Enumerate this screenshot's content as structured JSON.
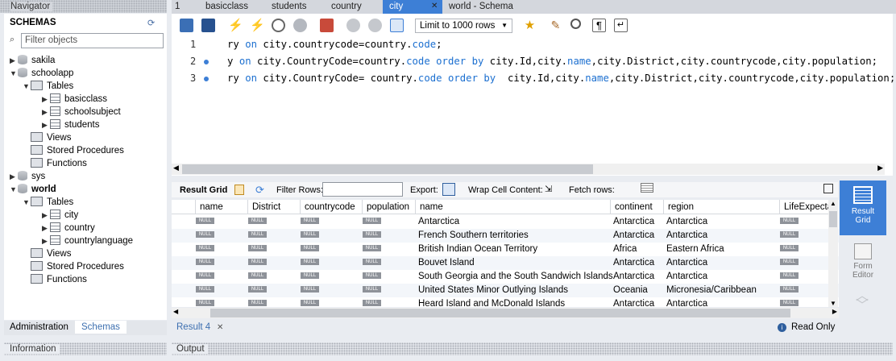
{
  "navigator": {
    "header": "Navigator",
    "schemas_title": "SCHEMAS",
    "filter_placeholder": "Filter objects"
  },
  "tree": [
    {
      "label": "sakila",
      "kind": "db",
      "arrow": "▶",
      "indent": 0
    },
    {
      "label": "schoolapp",
      "kind": "db",
      "arrow": "▼",
      "indent": 0
    },
    {
      "label": "Tables",
      "kind": "folder",
      "arrow": "▼",
      "indent": 1
    },
    {
      "label": "basicclass",
      "kind": "table",
      "arrow": "▶",
      "indent": 2
    },
    {
      "label": "schoolsubject",
      "kind": "table",
      "arrow": "▶",
      "indent": 2
    },
    {
      "label": "students",
      "kind": "table",
      "arrow": "▶",
      "indent": 2
    },
    {
      "label": "Views",
      "kind": "folder",
      "arrow": "",
      "indent": 1
    },
    {
      "label": "Stored Procedures",
      "kind": "folder",
      "arrow": "",
      "indent": 1
    },
    {
      "label": "Functions",
      "kind": "folder",
      "arrow": "",
      "indent": 1
    },
    {
      "label": "sys",
      "kind": "db",
      "arrow": "▶",
      "indent": 0
    },
    {
      "label": "world",
      "kind": "db",
      "arrow": "▼",
      "indent": 0,
      "bold": true
    },
    {
      "label": "Tables",
      "kind": "folder",
      "arrow": "▼",
      "indent": 1
    },
    {
      "label": "city",
      "kind": "table",
      "arrow": "▶",
      "indent": 2
    },
    {
      "label": "country",
      "kind": "table",
      "arrow": "▶",
      "indent": 2
    },
    {
      "label": "countrylanguage",
      "kind": "table",
      "arrow": "▶",
      "indent": 2
    },
    {
      "label": "Views",
      "kind": "folder",
      "arrow": "",
      "indent": 1
    },
    {
      "label": "Stored Procedures",
      "kind": "folder",
      "arrow": "",
      "indent": 1
    },
    {
      "label": "Functions",
      "kind": "folder",
      "arrow": "",
      "indent": 1
    }
  ],
  "bottom_tabs": {
    "administration": "Administration",
    "schemas": "Schemas"
  },
  "information_label": "Information",
  "output_label": "Output",
  "tabs": [
    {
      "label": "1"
    },
    {
      "label": "basicclass"
    },
    {
      "label": "students"
    },
    {
      "label": "country"
    },
    {
      "label": "city",
      "active": true
    },
    {
      "label": "world - Schema"
    }
  ],
  "tab_close": "✕",
  "toolbar": {
    "limit_label": "Limit to 1000 rows"
  },
  "editor": {
    "lines": [
      {
        "num": "1",
        "marker": false,
        "parts": [
          [
            "ry ",
            ""
          ],
          [
            "on",
            "kw"
          ],
          [
            " city.countrycode=country.",
            ""
          ],
          [
            "code",
            "kw"
          ],
          [
            ";",
            ""
          ]
        ]
      },
      {
        "num": "2",
        "marker": true,
        "parts": [
          [
            "y ",
            ""
          ],
          [
            "on",
            "kw"
          ],
          [
            " city.CountryCode=country.",
            ""
          ],
          [
            "code",
            "kw"
          ],
          [
            " ",
            ""
          ],
          [
            "order by",
            "kw"
          ],
          [
            " city.Id,city.",
            ""
          ],
          [
            "name",
            "kw"
          ],
          [
            ",city.District,city.countrycode,city.population;",
            ""
          ]
        ]
      },
      {
        "num": "3",
        "marker": true,
        "parts": [
          [
            "ry ",
            ""
          ],
          [
            "on",
            "kw"
          ],
          [
            " city.CountryCode= country.",
            ""
          ],
          [
            "code",
            "kw"
          ],
          [
            " ",
            ""
          ],
          [
            "order by",
            "kw"
          ],
          [
            "  city.Id,city.",
            ""
          ],
          [
            "name",
            "kw"
          ],
          [
            ",city.District,city.countrycode,city.population;",
            ""
          ]
        ]
      }
    ]
  },
  "result_toolbar": {
    "result_grid": "Result Grid",
    "filter_rows": "Filter Rows:",
    "export": "Export:",
    "wrap": "Wrap Cell Content:",
    "fetch": "Fetch rows:"
  },
  "grid": {
    "columns": [
      "name",
      "District",
      "countrycode",
      "population",
      "name",
      "continent",
      "region",
      "LifeExpecta"
    ],
    "null_text": "NULL",
    "rows": [
      [
        "Antarctica",
        "Antarctica",
        "Antarctica"
      ],
      [
        "French Southern territories",
        "Antarctica",
        "Antarctica"
      ],
      [
        "British Indian Ocean Territory",
        "Africa",
        "Eastern Africa"
      ],
      [
        "Bouvet Island",
        "Antarctica",
        "Antarctica"
      ],
      [
        "South Georgia and the South Sandwich Islands",
        "Antarctica",
        "Antarctica"
      ],
      [
        "United States Minor Outlying Islands",
        "Oceania",
        "Micronesia/Caribbean"
      ],
      [
        "Heard Island and McDonald Islands",
        "Antarctica",
        "Antarctica"
      ]
    ]
  },
  "side": {
    "result_grid": "Result\nGrid",
    "form_editor": "Form\nEditor"
  },
  "result_tab": "Result 4",
  "read_only": "Read Only",
  "colors": {
    "accent": "#3d7fd6",
    "keyword": "#1b6fd0"
  }
}
